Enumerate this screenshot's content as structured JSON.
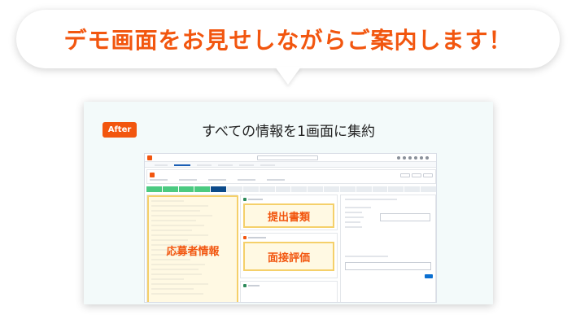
{
  "banner": {
    "text": "デモ画面をお見せしながらご案内します！",
    "color": "#f2560f"
  },
  "card": {
    "badge": "After",
    "title": "すべての情報を1画面に集約"
  },
  "screenshot": {
    "highlights": {
      "applicant_info": "応募者情報",
      "submitted_documents": "提出書類",
      "interview_evaluation": "面接評価"
    }
  }
}
